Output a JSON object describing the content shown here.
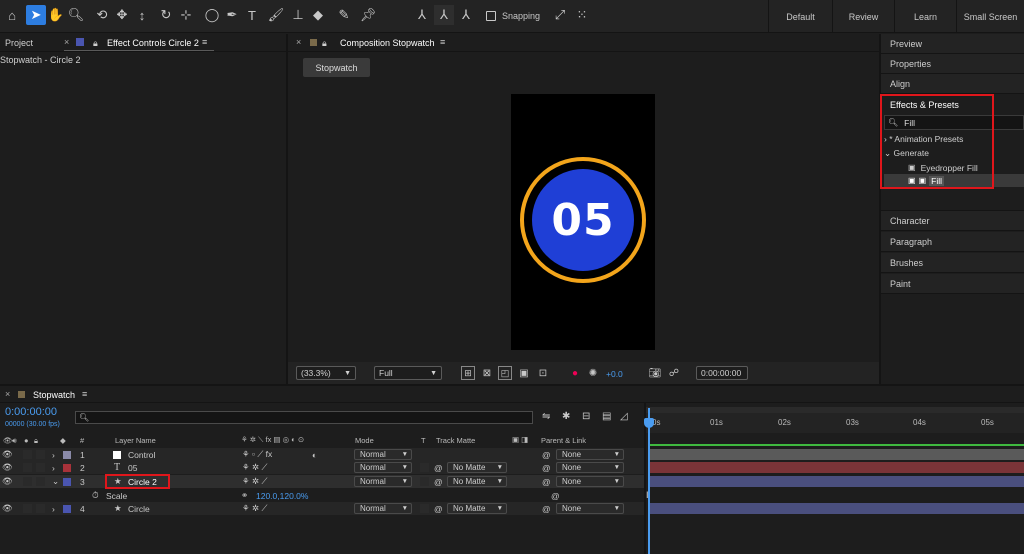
{
  "toolbar": {
    "snapping_label": "Snapping",
    "workspaces": [
      "Default",
      "Review",
      "Learn",
      "Small Screen"
    ]
  },
  "left_panel": {
    "tab_project": "Project",
    "tab_effect_controls": "Effect Controls Circle 2",
    "breadcrumb": "Stopwatch - Circle 2"
  },
  "composition": {
    "tab_label": "Composition Stopwatch",
    "flow_button": "Stopwatch",
    "number_text": "05",
    "zoom": "(33.3%)",
    "resolution": "Full",
    "exposure": "+0.0",
    "timecode": "0:00:00:00",
    "colors": {
      "ring": "#f3a51b",
      "circle": "#1f3fd6",
      "canvas": "#000000"
    }
  },
  "right_panel": {
    "items_top": [
      "Preview",
      "Properties",
      "Align"
    ],
    "effects_title": "Effects & Presets",
    "search_value": "Fill",
    "tree": {
      "animation_presets": "* Animation Presets",
      "generate": "Generate",
      "eyedropper_fill": "Eyedropper Fill",
      "fill": "Fill"
    },
    "items_bottom": [
      "Character",
      "Paragraph",
      "Brushes",
      "Paint"
    ]
  },
  "timeline": {
    "tab_label": "Stopwatch",
    "current_time": "0:00:00:00",
    "fps_note": "00000 (30.00 fps)",
    "headers": {
      "layer_name": "Layer Name",
      "number": "#",
      "mode": "Mode",
      "t": "T",
      "track_matte": "Track Matte",
      "parent": "Parent & Link"
    },
    "ruler": [
      "0s",
      "01s",
      "02s",
      "03s",
      "04s",
      "05s"
    ],
    "layers": [
      {
        "num": "1",
        "name": "Control",
        "mode": "Normal",
        "matte": "",
        "parent": "None",
        "label_color": "#8a8aa8",
        "bar_color": "#5a5a5a"
      },
      {
        "num": "2",
        "name": "05",
        "mode": "Normal",
        "matte": "No Matte",
        "parent": "None",
        "label_color": "#a8323a",
        "bar_color": "#7a3438"
      },
      {
        "num": "3",
        "name": "Circle 2",
        "mode": "Normal",
        "matte": "No Matte",
        "parent": "None",
        "label_color": "#4a55b0",
        "bar_color": "#4a4f7e"
      },
      {
        "num": "4",
        "name": "Circle",
        "mode": "Normal",
        "matte": "No Matte",
        "parent": "None",
        "label_color": "#4a55b0",
        "bar_color": "#4a4f7e"
      }
    ],
    "scale_property": {
      "name": "Scale",
      "value": "120.0,120.0%"
    }
  }
}
